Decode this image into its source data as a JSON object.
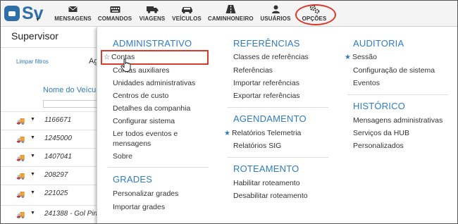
{
  "app": {
    "logo_text": "Sv"
  },
  "nav": [
    {
      "label": "MENSAGENS",
      "icon": "envelope-icon"
    },
    {
      "label": "COMANDOS",
      "icon": "keyboard-icon"
    },
    {
      "label": "VIAGENS",
      "icon": "truck-icon"
    },
    {
      "label": "VEÍCULOS",
      "icon": "car-icon"
    },
    {
      "label": "CAMINHONEIRO",
      "icon": "road-icon"
    },
    {
      "label": "USUÁRIOS",
      "icon": "user-icon"
    },
    {
      "label": "OPÇÕES",
      "icon": "gears-icon"
    }
  ],
  "page": {
    "title": "Supervisor",
    "clear_filters": "Limpar filtros",
    "partial_label": "Ag",
    "column_header": "Nome do Veículo",
    "rows": [
      "1166671",
      "1245000",
      "1407041",
      "208297",
      "221025",
      "241388 - Gol Pin"
    ]
  },
  "menu": {
    "administrativo": {
      "title": "ADMINISTRATIVO",
      "items": [
        "Contas",
        "Contas auxiliares",
        "Unidades administrativas",
        "Centros de custo",
        "Detalhes da companhia",
        "Configurar sistema",
        "Ler todos eventos e",
        "mensagens",
        "Sobre"
      ]
    },
    "grades": {
      "title": "GRADES",
      "items": [
        "Personalizar grades",
        "Importar grades"
      ]
    },
    "referencias": {
      "title": "REFERÊNCIAS",
      "items": [
        "Classes de referências",
        "Referências",
        "Importar referências",
        "Exportar referências"
      ]
    },
    "agendamento": {
      "title": "AGENDAMENTO",
      "items": [
        "Relatórios Telemetria",
        "Relatórios SIG"
      ]
    },
    "roteamento": {
      "title": "ROTEAMENTO",
      "items": [
        "Habilitar roteamento",
        "Desabilitar roteamento"
      ]
    },
    "auditoria": {
      "title": "AUDITORIA",
      "items": [
        "Sessão",
        "Configuração de sistema",
        "Eventos"
      ]
    },
    "historico": {
      "title": "HISTÓRICO",
      "items": [
        "Mensagens administrativas",
        "Serviços da HUB",
        "Personalizados"
      ]
    }
  },
  "colors": {
    "accent": "#2f7cc0",
    "highlight": "#d93a2b",
    "logo": "#2f6ea8"
  }
}
